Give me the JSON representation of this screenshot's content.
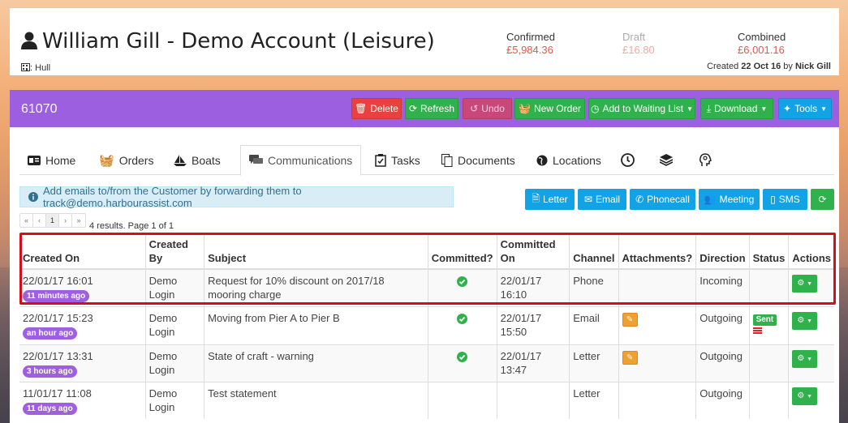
{
  "header": {
    "title": "William Gill - Demo Account (Leisure)",
    "location": "Hull",
    "confirmed_label": "Confirmed",
    "confirmed_value": "£5,984.36",
    "draft_label": "Draft",
    "draft_value": "£16.80",
    "combined_label": "Combined",
    "combined_value": "£6,001.16",
    "created_prefix": "Created",
    "created_date": "22 Oct 16",
    "created_by_word": "by",
    "created_by": "Nick Gill"
  },
  "toolbar": {
    "account_number": "61070",
    "delete": "Delete",
    "refresh": "Refresh",
    "undo": "Undo",
    "new_order": "New Order",
    "waiting_list": "Add to Waiting List",
    "download": "Download",
    "tools": "Tools"
  },
  "tabs": {
    "home": "Home",
    "orders": "Orders",
    "boats": "Boats",
    "communications": "Communications",
    "tasks": "Tasks",
    "documents": "Documents",
    "locations": "Locations"
  },
  "comms": {
    "info": "Add emails to/from the Customer by forwarding them to track@demo.harbourassist.com",
    "letter": "Letter",
    "email": "Email",
    "phonecall": "Phonecall",
    "meeting": "Meeting",
    "sms": "SMS"
  },
  "pager": {
    "first": "«",
    "prev": "‹",
    "page": "1",
    "next": "›",
    "last": "»",
    "results": "4 results. Page 1 of 1"
  },
  "table": {
    "headers": {
      "created_on": "Created On",
      "created_by_1": "Created",
      "created_by_2": "By",
      "subject": "Subject",
      "committed": "Committed?",
      "committed_on_1": "Committed",
      "committed_on_2": "On",
      "channel": "Channel",
      "attachments": "Attachments?",
      "direction": "Direction",
      "status": "Status",
      "actions": "Actions"
    },
    "rows": [
      {
        "created_on": "22/01/17 16:01",
        "ago": "11 minutes ago",
        "by_1": "Demo",
        "by_2": "Login",
        "subject": "Request for 10% discount on 2017/18 mooring charge",
        "committed_date": "22/01/17",
        "committed_time": "16:10",
        "channel": "Phone",
        "direction": "Incoming"
      },
      {
        "created_on": "22/01/17 15:23",
        "ago": "an hour ago",
        "by_1": "Demo",
        "by_2": "Login",
        "subject": "Moving from Pier A to Pier B",
        "committed_date": "22/01/17",
        "committed_time": "15:50",
        "channel": "Email",
        "direction": "Outgoing",
        "status": "Sent"
      },
      {
        "created_on": "22/01/17 13:31",
        "ago": "3 hours ago",
        "by_1": "Demo",
        "by_2": "Login",
        "subject": "State of craft - warning",
        "committed_date": "22/01/17",
        "committed_time": "13:47",
        "channel": "Letter",
        "direction": "Outgoing"
      },
      {
        "created_on": "11/01/17 11:08",
        "ago": "11 days ago",
        "by_1": "Demo",
        "by_2": "Login",
        "subject": "Test statement",
        "channel": "Letter",
        "direction": "Outgoing"
      }
    ]
  },
  "colors": {
    "purple": "#9b5fe0",
    "green": "#2fb14b",
    "red": "#e8413e",
    "blue": "#12a3e6",
    "highlight": "#d3101a"
  }
}
